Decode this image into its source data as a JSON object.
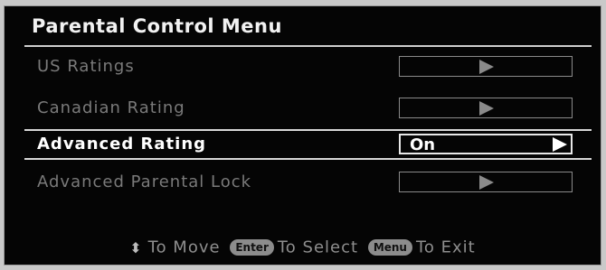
{
  "menu": {
    "title": "Parental Control Menu",
    "items": [
      {
        "label": "US Ratings",
        "value": ""
      },
      {
        "label": "Canadian Rating",
        "value": ""
      },
      {
        "label": "Advanced Rating",
        "value": "On",
        "selected": true
      },
      {
        "label": "Advanced Parental Lock",
        "value": ""
      }
    ]
  },
  "footer": {
    "move_icon": "up-down-arrows-icon",
    "move_text": "To Move",
    "enter_key": "Enter",
    "select_text": "To Select",
    "menu_key": "Menu",
    "exit_text": "To Exit"
  }
}
